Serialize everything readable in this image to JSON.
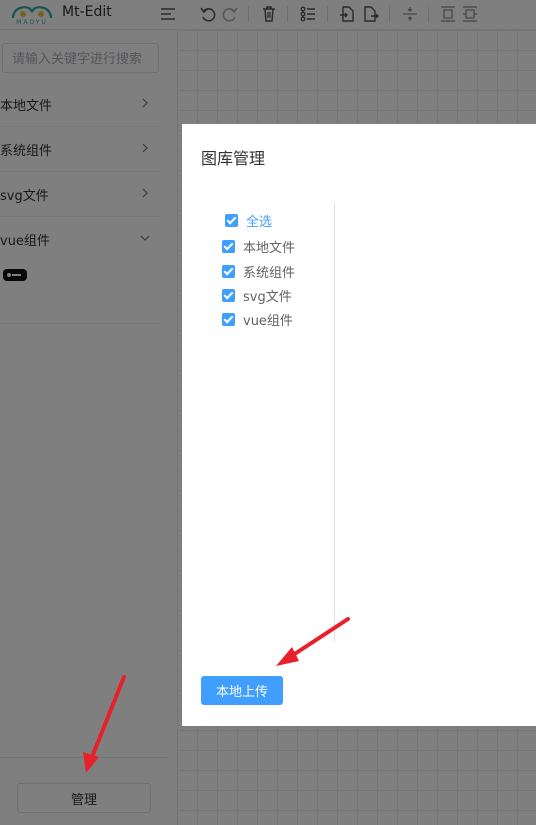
{
  "app": {
    "title": "Mt-Edit",
    "logo_text": "MAOYU"
  },
  "toolbar": {
    "buttons": [
      "menu-icon",
      "undo-icon",
      "redo-icon",
      "delete-icon",
      "list-icon",
      "import-icon",
      "export-icon",
      "align-center-icon",
      "align-top-icon",
      "align-middle-icon"
    ]
  },
  "sidebar": {
    "search_placeholder": "请输入关键字进行搜索",
    "categories": [
      {
        "label": "本地文件",
        "expanded": false
      },
      {
        "label": "系统组件",
        "expanded": false
      },
      {
        "label": "svg文件",
        "expanded": false
      },
      {
        "label": "vue组件",
        "expanded": true
      }
    ],
    "manage_label": "管理"
  },
  "dialog": {
    "title": "图库管理",
    "select_all": "全选",
    "items": [
      "本地文件",
      "系统组件",
      "svg文件",
      "vue组件"
    ],
    "upload_label": "本地上传"
  },
  "colors": {
    "primary": "#409eff",
    "annotation_arrow": "#e8202a",
    "logo": "#30a4a4"
  }
}
